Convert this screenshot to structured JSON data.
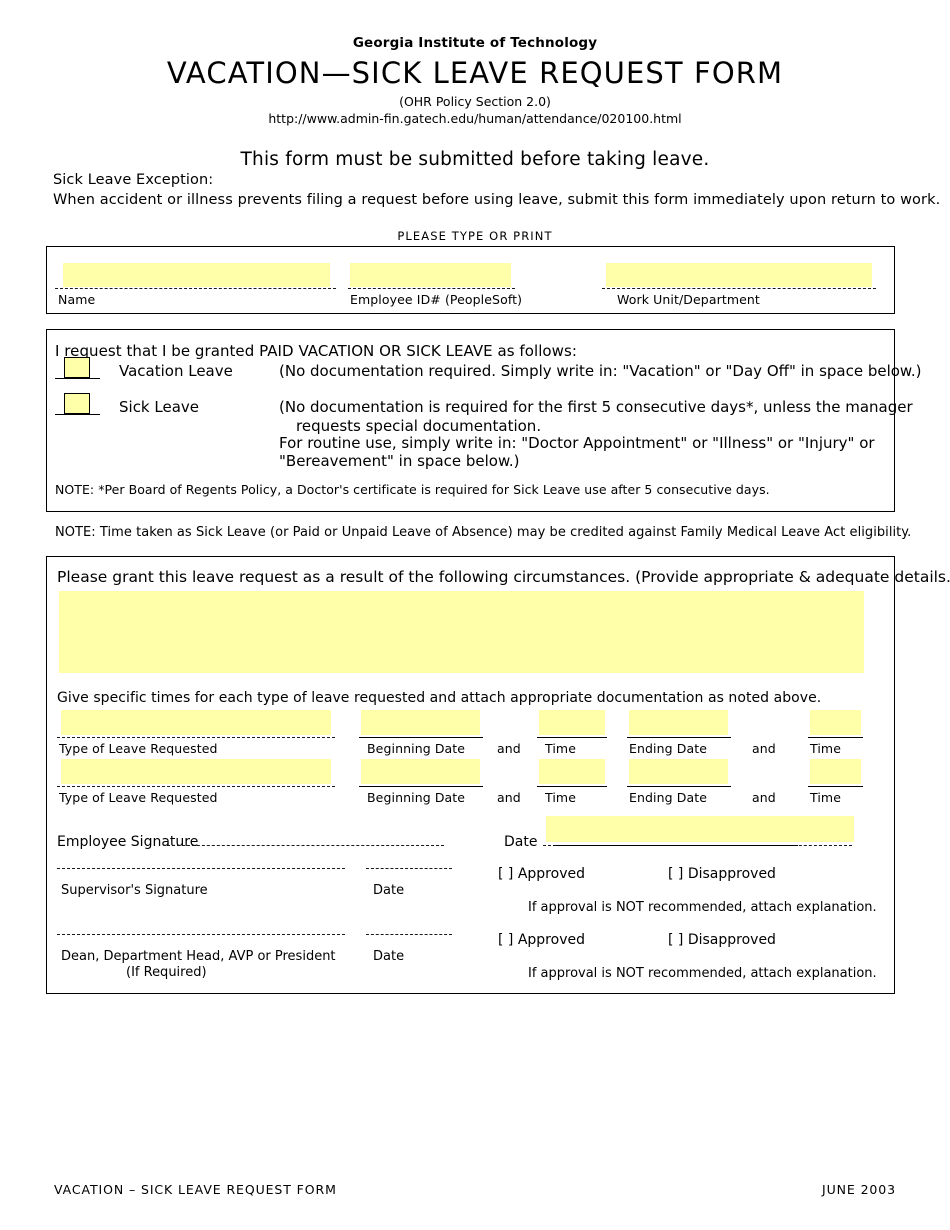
{
  "header": {
    "organization": "Georgia Institute of Technology",
    "title": "VACATION—SICK LEAVE REQUEST FORM",
    "policy": "(OHR Policy Section 2.0)",
    "url": "http://www.admin-fin.gatech.edu/human/attendance/020100.html",
    "must_submit": "This form must be submitted before taking leave."
  },
  "exception": {
    "heading": "Sick Leave Exception:",
    "text": "When accident or illness prevents filing a request before using leave, submit this form immediately upon return to work."
  },
  "please_type": "PLEASE TYPE OR PRINT",
  "identity": {
    "name_label": "Name",
    "name_value": "",
    "employee_id_label": "Employee ID# (PeopleSoft)",
    "employee_id_value": "",
    "work_unit_label": "Work Unit/Department",
    "work_unit_value": ""
  },
  "leave_type": {
    "intro": "I request that I be granted PAID VACATION OR SICK LEAVE as follows:",
    "vacation": {
      "label": "Vacation Leave",
      "checked": false,
      "description": "(No documentation required. Simply write in: \"Vacation\" or \"Day Off\" in space below.)"
    },
    "sick": {
      "label": "Sick Leave",
      "checked": false,
      "description_line1": "(No documentation is required for the first 5 consecutive days*, unless the manager",
      "description_line2": "requests special documentation.",
      "description_line3": "For routine use, simply write in: \"Doctor Appointment\" or \"Illness\" or \"Injury\" or",
      "description_line4": "\"Bereavement\" in space below.)"
    },
    "note": "NOTE:  *Per Board of Regents Policy, a Doctor's certificate is required for Sick Leave use after 5 consecutive days."
  },
  "fmla_note": "NOTE: Time taken as Sick Leave (or Paid or Unpaid Leave of Absence) may be credited against Family Medical Leave Act eligibility.",
  "details": {
    "prompt": "Please grant this leave request as a result of the following circumstances. (Provide appropriate & adequate details.)",
    "circumstances_value": "",
    "give_times": "Give specific times for each type of leave requested and attach appropriate documentation as noted above.",
    "column_labels": {
      "type_of_leave": "Type of Leave Requested",
      "beginning_date": "Beginning Date",
      "and": "and",
      "time": "Time",
      "ending_date": "Ending Date"
    },
    "rows": [
      {
        "type_of_leave": "",
        "beginning_date": "",
        "begin_time": "",
        "ending_date": "",
        "end_time": ""
      },
      {
        "type_of_leave": "",
        "beginning_date": "",
        "begin_time": "",
        "ending_date": "",
        "end_time": ""
      }
    ]
  },
  "signatures": {
    "employee_signature_label": "Employee Signature",
    "employee_signature_value": "",
    "employee_date_label": "Date",
    "employee_date_value": "",
    "supervisor_signature_label": "Supervisor's Signature",
    "supervisor_signature_value": "",
    "supervisor_date_label": "Date",
    "supervisor_date_value": "",
    "dean_signature_label": "Dean, Department Head, AVP or President",
    "dean_signature_sub": "(If Required)",
    "dean_signature_value": "",
    "dean_date_label": "Date",
    "dean_date_value": "",
    "approved_label": "[  ]  Approved",
    "disapproved_label": "[  ]  Disapproved",
    "explanation_note": "If approval is NOT recommended, attach explanation."
  },
  "footer": {
    "left": "VACATION – SICK LEAVE REQUEST FORM",
    "right": "JUNE 2003"
  }
}
